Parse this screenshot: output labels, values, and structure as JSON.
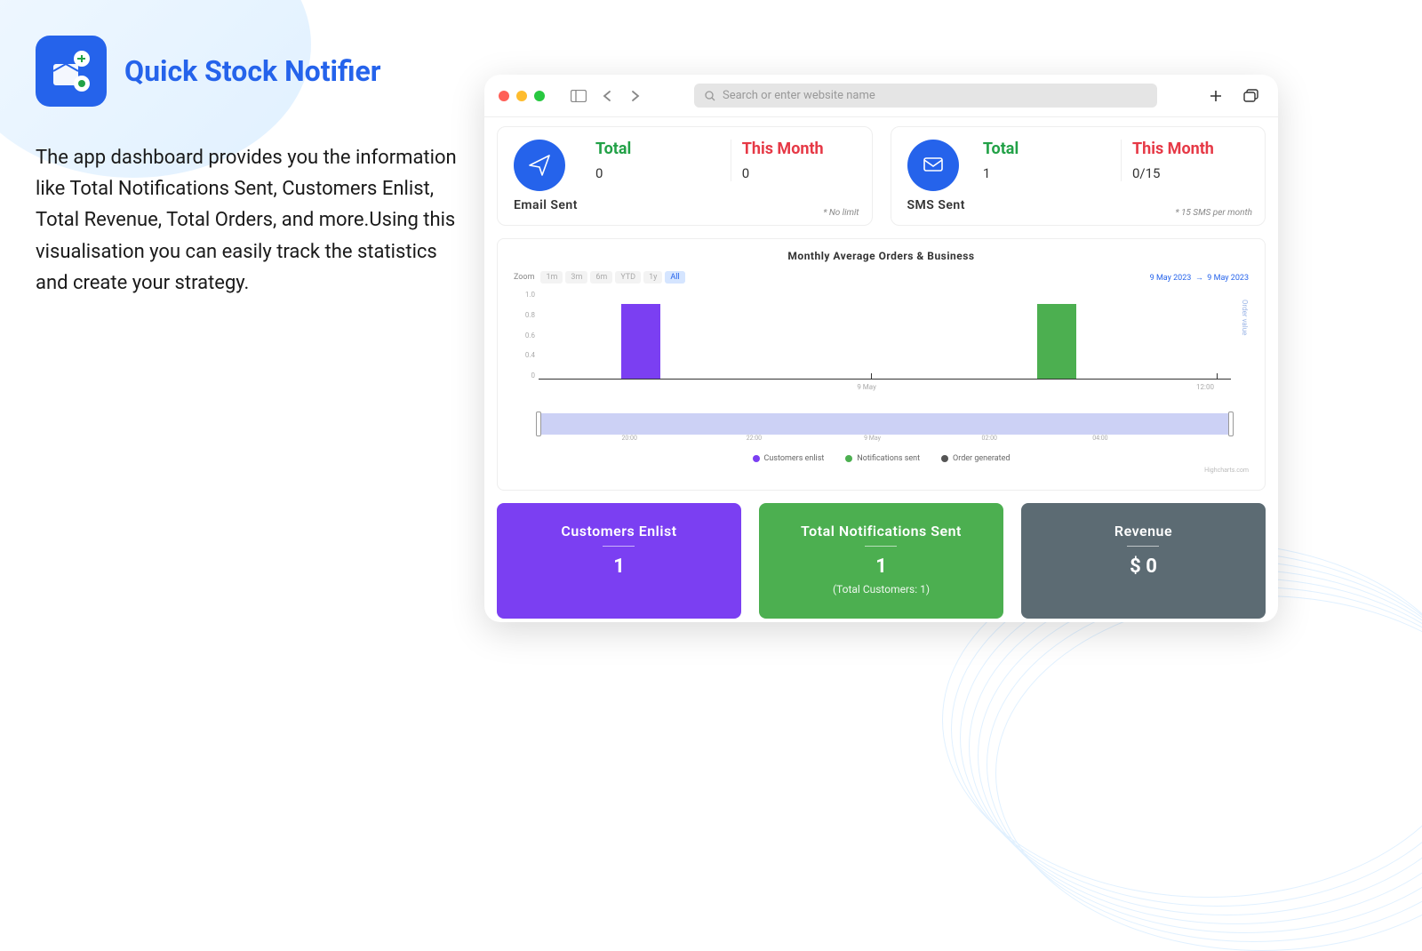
{
  "app": {
    "title": "Quick Stock Notifier",
    "description": "The app dashboard provides you the information like Total Notifications Sent, Customers Enlist, Total Revenue, Total Orders, and more.Using this visualisation you can easily track the statistics and create your strategy."
  },
  "browser": {
    "search_placeholder": "Search or enter website name"
  },
  "stats": {
    "email": {
      "label": "Email Sent",
      "total_label": "Total",
      "total_value": "0",
      "month_label": "This Month",
      "month_value": "0",
      "note": "* No limit"
    },
    "sms": {
      "label": "SMS Sent",
      "total_label": "Total",
      "total_value": "1",
      "month_label": "This Month",
      "month_value": "0/15",
      "note": "* 15 SMS per month"
    }
  },
  "chart": {
    "title": "Monthly Average Orders & Business",
    "zoom_label": "Zoom",
    "zoom": [
      "1m",
      "3m",
      "6m",
      "YTD",
      "1y",
      "All"
    ],
    "zoom_active": "All",
    "date_from": "9 May 2023",
    "date_to": "9 May 2023",
    "y_right_label": "Order value",
    "legend": {
      "enlist": "Customers enlist",
      "notif": "Notifications sent",
      "order": "Order generated"
    },
    "x_tick1": "9 May",
    "x_tick2": "12:00",
    "range_ticks": [
      "20:00",
      "22:00",
      "9 May",
      "02:00",
      "04:00"
    ],
    "y_ticks": [
      "1.0",
      "0.8",
      "0.6",
      "0.4",
      "0"
    ],
    "credit": "Highcharts.com"
  },
  "chart_data": {
    "type": "bar",
    "categories": [
      "9 May",
      "12:00"
    ],
    "series": [
      {
        "name": "Customers enlist",
        "color": "#7b3ff2",
        "values": [
          1,
          0
        ]
      },
      {
        "name": "Notifications sent",
        "color": "#4caf50",
        "values": [
          0,
          1
        ]
      },
      {
        "name": "Order generated",
        "color": "#555555",
        "values": [
          0,
          0
        ]
      }
    ],
    "title": "Monthly Average Orders & Business",
    "xlabel": "",
    "ylabel": "",
    "ylim": [
      0,
      1.0
    ]
  },
  "bottom": {
    "enlist": {
      "title": "Customers Enlist",
      "value": "1"
    },
    "notif": {
      "title": "Total Notifications Sent",
      "value": "1",
      "sub": "(Total Customers: 1)"
    },
    "revenue": {
      "title": "Revenue",
      "value": "$  0"
    }
  }
}
